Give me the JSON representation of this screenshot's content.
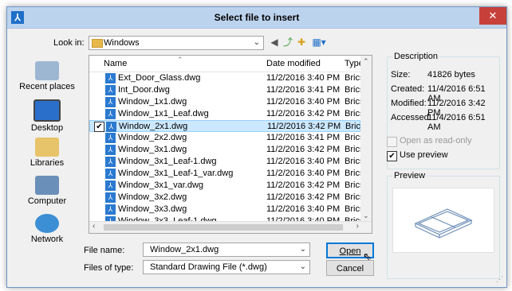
{
  "window": {
    "title": "Select file to insert",
    "app_icon_glyph": "⅄",
    "close_glyph": "✕"
  },
  "lookin": {
    "label": "Look in:",
    "value": "Windows"
  },
  "toolbar": {
    "back": "◀",
    "up": "⤴",
    "newfolder": "✚",
    "views": "▦▾"
  },
  "places": [
    "Recent places",
    "Desktop",
    "Libraries",
    "Computer",
    "Network"
  ],
  "columns": {
    "name": "Name",
    "date": "Date modified",
    "type": "Type"
  },
  "files": [
    {
      "name": "Ext_Door_Glass.dwg",
      "date": "11/2/2016 3:40 PM",
      "type": "BricsCAD"
    },
    {
      "name": "Int_Door.dwg",
      "date": "11/2/2016 3:41 PM",
      "type": "BricsCAD"
    },
    {
      "name": "Window_1x1.dwg",
      "date": "11/2/2016 3:40 PM",
      "type": "BricsCAD"
    },
    {
      "name": "Window_1x1_Leaf.dwg",
      "date": "11/2/2016 3:42 PM",
      "type": "BricsCAD"
    },
    {
      "name": "Window_2x1.dwg",
      "date": "11/2/2016 3:42 PM",
      "type": "BricsCAD"
    },
    {
      "name": "Window_2x2.dwg",
      "date": "11/2/2016 3:41 PM",
      "type": "BricsCAD"
    },
    {
      "name": "Window_3x1.dwg",
      "date": "11/2/2016 3:42 PM",
      "type": "BricsCAD"
    },
    {
      "name": "Window_3x1_Leaf-1.dwg",
      "date": "11/2/2016 3:40 PM",
      "type": "BricsCAD"
    },
    {
      "name": "Window_3x1_Leaf-1_var.dwg",
      "date": "11/2/2016 3:40 PM",
      "type": "BricsCAD"
    },
    {
      "name": "Window_3x1_var.dwg",
      "date": "11/2/2016 3:42 PM",
      "type": "BricsCAD"
    },
    {
      "name": "Window_3x2.dwg",
      "date": "11/2/2016 3:42 PM",
      "type": "BricsCAD"
    },
    {
      "name": "Window_3x3.dwg",
      "date": "11/2/2016 3:40 PM",
      "type": "BricsCAD"
    },
    {
      "name": "Window_3x3_Leaf-1.dwg",
      "date": "11/2/2016 3:40 PM",
      "type": "BricsCAD"
    }
  ],
  "selected_file": "Window_2x1.dwg",
  "filename": {
    "label": "File name:",
    "value": "Window_2x1.dwg"
  },
  "filetype": {
    "label": "Files of type:",
    "value": "Standard Drawing File (*.dwg)"
  },
  "buttons": {
    "open": "Open",
    "cancel": "Cancel"
  },
  "description": {
    "caption": "Description",
    "size_label": "Size:",
    "size": "41826 bytes",
    "created_label": "Created:",
    "created": "11/4/2016 6:51 AM",
    "modified_label": "Modified:",
    "modified": "11/2/2016 3:42 PM",
    "accessed_label": "Accessed:",
    "accessed": "11/4/2016 6:51 AM"
  },
  "options": {
    "readonly": "Open as read-only",
    "preview": "Use preview",
    "use_preview_checked": true,
    "readonly_checked": false
  },
  "preview": {
    "caption": "Preview"
  },
  "colors": {
    "title_bg": "#bcd3ee",
    "close_bg": "#c7413a",
    "selection": "#cce8ff",
    "dwg_icon": "#2b7ad0"
  }
}
